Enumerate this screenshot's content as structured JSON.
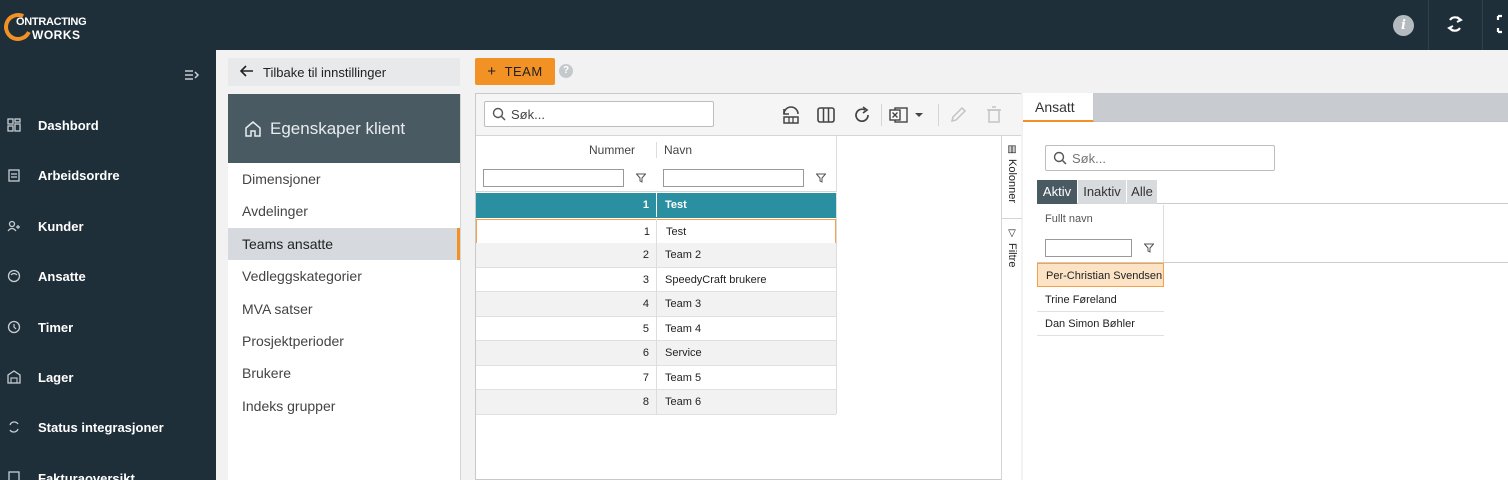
{
  "app": {
    "logo_line1": "ONTRACTING",
    "logo_line2": "WORKS",
    "info_glyph": "i"
  },
  "nav": {
    "items": [
      {
        "label": "Dashbord",
        "icon": "dashboard-icon"
      },
      {
        "label": "Arbeidsordre",
        "icon": "clipboard-icon"
      },
      {
        "label": "Kunder",
        "icon": "customers-icon"
      },
      {
        "label": "Ansatte",
        "icon": "employees-icon"
      },
      {
        "label": "Timer",
        "icon": "clock-icon"
      },
      {
        "label": "Lager",
        "icon": "warehouse-icon"
      },
      {
        "label": "Status integrasjoner",
        "icon": "sync-icon"
      },
      {
        "label": "Fakturaoversikt",
        "icon": "invoice-icon"
      }
    ]
  },
  "settings": {
    "back_label": "Tilbake til innstillinger",
    "title": "Egenskaper klient",
    "items": [
      {
        "label": "Dimensjoner",
        "active": false
      },
      {
        "label": "Avdelinger",
        "active": false
      },
      {
        "label": "Teams ansatte",
        "active": true
      },
      {
        "label": "Vedleggskategorier",
        "active": false
      },
      {
        "label": "MVA satser",
        "active": false
      },
      {
        "label": "Prosjektperioder",
        "active": false
      },
      {
        "label": "Brukere",
        "active": false
      },
      {
        "label": "Indeks grupper",
        "active": false
      }
    ]
  },
  "team_button": {
    "plus": "+",
    "label": "TEAM"
  },
  "help_glyph": "?",
  "grid": {
    "search_placeholder": "Søk...",
    "columns": [
      "Nummer",
      "Navn"
    ],
    "selected_row": {
      "num": "1",
      "name": "Test"
    },
    "rows": [
      {
        "num": "1",
        "name": "Test"
      },
      {
        "num": "2",
        "name": "Team 2"
      },
      {
        "num": "3",
        "name": "SpeedyCraft brukere"
      },
      {
        "num": "4",
        "name": "Team 3"
      },
      {
        "num": "5",
        "name": "Team 4"
      },
      {
        "num": "6",
        "name": "Service"
      },
      {
        "num": "7",
        "name": "Team 5"
      },
      {
        "num": "8",
        "name": "Team 6"
      }
    ],
    "side_tabs": [
      "Kolonner",
      "Filtre"
    ]
  },
  "right": {
    "tab_label": "Ansatt",
    "search_placeholder": "Søk...",
    "status_tabs": [
      "Aktiv",
      "Inaktiv",
      "Alle"
    ],
    "column": "Fullt navn",
    "rows": [
      "Per-Christian Svendsen",
      "Trine Føreland",
      "Dan Simon Bøhler"
    ]
  },
  "colors": {
    "accent": "#f39224",
    "nav_bg": "#1f2f3a",
    "selected_row": "#2a8fa0",
    "header_bg": "#4a5a63"
  }
}
